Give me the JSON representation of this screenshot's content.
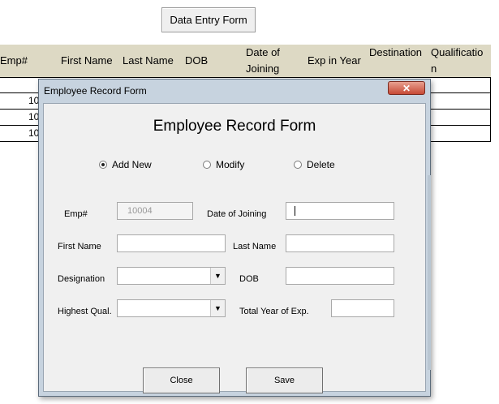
{
  "sheet": {
    "button_label": "Data Entry Form",
    "headers": [
      "Emp#",
      "First Name",
      "Last Name",
      "DOB",
      "Date of Joining",
      "Exp in Year",
      "Destination",
      "Qualification"
    ],
    "row_prefixes": [
      "",
      "10",
      "10",
      "10"
    ]
  },
  "dialog": {
    "title": "Employee Record Form",
    "close_glyph": "✕",
    "heading": "Employee Record Form",
    "modes": [
      {
        "label": "Add New",
        "selected": true
      },
      {
        "label": "Modify",
        "selected": false
      },
      {
        "label": "Delete",
        "selected": false
      }
    ],
    "fields": {
      "emp_no": {
        "label": "Emp#",
        "value": "10004"
      },
      "date_of_joining": {
        "label": "Date of Joining",
        "value": ""
      },
      "first_name": {
        "label": "First Name",
        "value": ""
      },
      "last_name": {
        "label": "Last Name",
        "value": ""
      },
      "designation": {
        "label": "Designation",
        "value": ""
      },
      "dob": {
        "label": "DOB",
        "value": ""
      },
      "highest_qual": {
        "label": "Highest Qual.",
        "value": ""
      },
      "total_exp": {
        "label": "Total Year of Exp.",
        "value": ""
      }
    },
    "buttons": {
      "close": "Close",
      "save": "Save"
    }
  }
}
